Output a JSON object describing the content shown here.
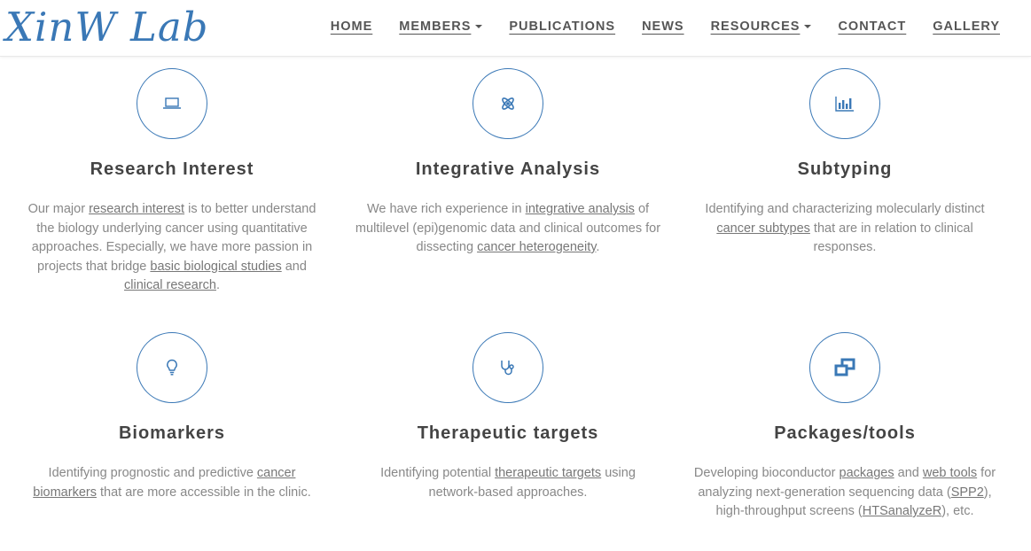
{
  "brand": {
    "name": "XinW Lab"
  },
  "nav": {
    "home": "HOME",
    "members": "MEMBERS",
    "publications": "PUBLICATIONS",
    "news": "NEWS",
    "resources": "RESOURCES",
    "contact": "CONTACT",
    "gallery": "GALLERY"
  },
  "colors": {
    "accent": "#3a78b6",
    "heading": "#444444",
    "body": "#888888"
  },
  "features": [
    {
      "icon": "laptop-icon",
      "title": "Research Interest",
      "t1": "Our major ",
      "l1": "research interest",
      "t2": " is to better understand the biology underlying cancer using quantitative approaches. Especially, we have more passion in projects that bridge ",
      "l2": "basic biological studies",
      "t3": " and ",
      "l3": "clinical research",
      "t4": "."
    },
    {
      "icon": "molecule-icon",
      "title": "Integrative Analysis",
      "t1": "We have rich experience in ",
      "l1": "integrative analysis",
      "t2": " of multilevel (epi)genomic data and clinical outcomes for dissecting ",
      "l2": "cancer heterogeneity",
      "t3": "."
    },
    {
      "icon": "bar-chart-icon",
      "title": "Subtyping",
      "t1": "Identifying and characterizing molecularly distinct ",
      "l1": "cancer subtypes",
      "t2": " that are in relation to clinical responses."
    },
    {
      "icon": "lightbulb-icon",
      "title": "Biomarkers",
      "t1": "Identifying prognostic and predictive ",
      "l1": "cancer biomarkers",
      "t2": " that are more accessible in the clinic."
    },
    {
      "icon": "stethoscope-icon",
      "title": "Therapeutic targets",
      "t1": "Identifying potential ",
      "l1": "therapeutic targets",
      "t2": " using network-based approaches."
    },
    {
      "icon": "windows-icon",
      "title": "Packages/tools",
      "t1": "Developing bioconductor ",
      "l1": "packages",
      "t2": " and ",
      "l2": "web tools",
      "t3": " for analyzing next-generation sequencing data (",
      "l3": "SPP2",
      "t4": "), high-throughput screens (",
      "l4": "HTSanalyzeR",
      "t5": "), etc."
    }
  ]
}
